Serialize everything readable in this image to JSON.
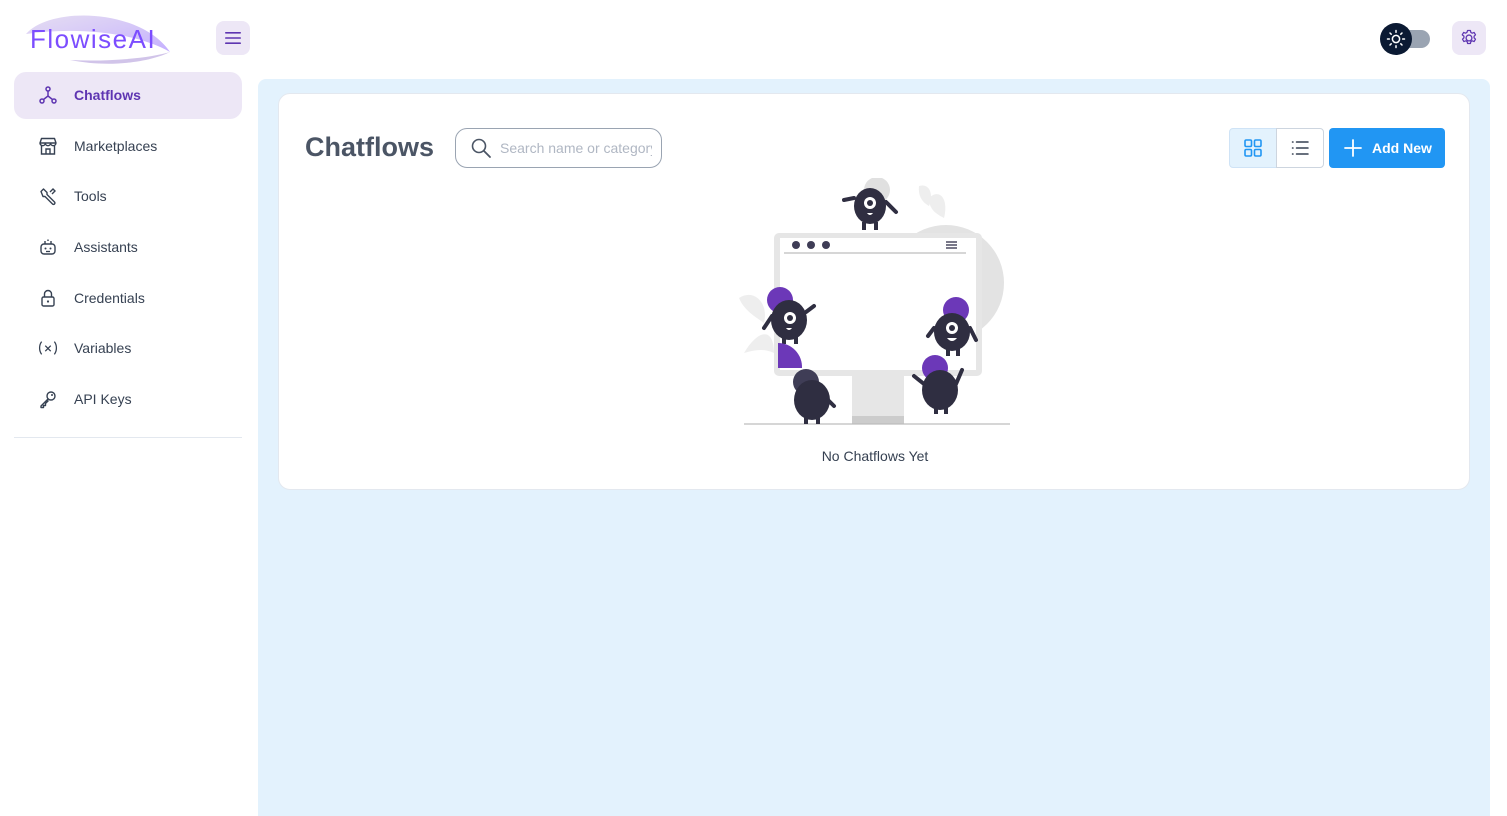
{
  "app": {
    "logo_text": "FlowiseAI",
    "brand_color": "#7c4dff",
    "accent_color": "#2196f3"
  },
  "header": {
    "menu_icon": "hamburger-icon",
    "theme_icon": "sun-icon",
    "settings_icon": "gear-icon"
  },
  "sidebar": {
    "items": [
      {
        "label": "Chatflows",
        "icon": "chatflow-icon",
        "active": true
      },
      {
        "label": "Marketplaces",
        "icon": "store-icon",
        "active": false
      },
      {
        "label": "Tools",
        "icon": "wrench-icon",
        "active": false
      },
      {
        "label": "Assistants",
        "icon": "robot-icon",
        "active": false
      },
      {
        "label": "Credentials",
        "icon": "lock-icon",
        "active": false
      },
      {
        "label": "Variables",
        "icon": "variable-icon",
        "active": false
      },
      {
        "label": "API Keys",
        "icon": "key-icon",
        "active": false
      }
    ]
  },
  "main": {
    "title": "Chatflows",
    "search": {
      "placeholder": "Search name or category",
      "value": ""
    },
    "view_mode": "grid",
    "add_button_label": "Add New",
    "empty_text": "No Chatflows Yet"
  }
}
